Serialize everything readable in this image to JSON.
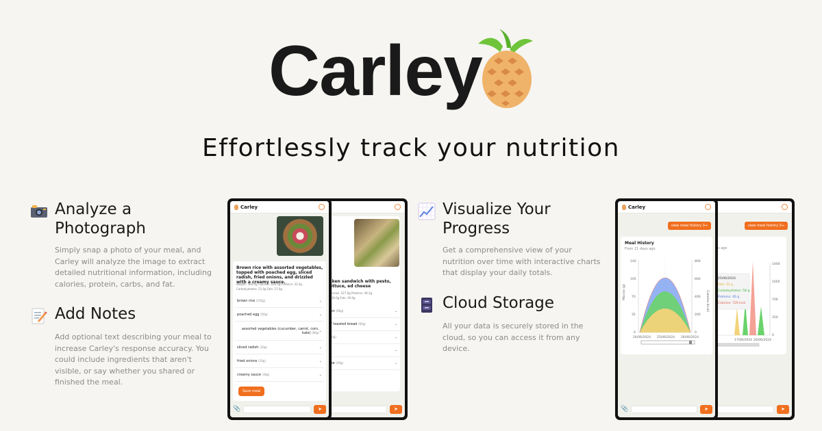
{
  "hero": {
    "title": "Carley",
    "tagline": "Effortlessly track your nutrition"
  },
  "features": [
    {
      "title": "Analyze a Photograph",
      "desc": "Simply snap a photo of your meal, and Carley will analyze the image to extract detailed nutritional information, including calories, protein, carbs, and fat.",
      "icon": "camera-icon"
    },
    {
      "title": "Add Notes",
      "desc": "Add optional text describing your meal to increase Carley's response accuracy. You could include ingredients that aren't visible, or say whether you shared or finished the meal.",
      "icon": "memo-icon"
    },
    {
      "title": "Visualize Your Progress",
      "desc": "Get a comprehensive view of your nutrition over time with interactive charts that display your daily totals.",
      "icon": "chart-icon"
    },
    {
      "title": "Cloud Storage",
      "desc": "All your data is securely stored in the cloud, so you can access it from any device.",
      "icon": "storage-icon"
    }
  ],
  "app": {
    "name": "Carley",
    "meal1": {
      "title": "Brown rice with assorted vegetables, topped with poached egg, sliced radish, fried onions, and drizzled with a creamy sauce.",
      "stats": "Weight: 560.0g  Calories: 690.0g  Proteins: 32.2g",
      "stats2": "Carbohydrates: 51.0g  Fats: 27.0g",
      "items": [
        {
          "name": "brown rice",
          "qty": "(150g)"
        },
        {
          "name": "poached egg",
          "qty": "(50g)"
        },
        {
          "name": "assorted vegetables (cucumber, carrot, corn, kale)",
          "qty": "(90g)"
        },
        {
          "name": "sliced radish",
          "qty": "(20g)"
        },
        {
          "name": "fried onions",
          "qty": "(10g)"
        },
        {
          "name": "creamy sauce",
          "qty": "(30g)"
        }
      ],
      "save": "Save meal"
    },
    "meal2": {
      "title": "icken sandwich with pesto, lettuce, ed cheese",
      "stats": "Calories: 527.0g  Proteins: 46.2g",
      "stats2": "s: 30.0g  Fats: 29.0g",
      "items": [
        {
          "name": "ken",
          "qty": "(90g)"
        },
        {
          "name": "of toasted bread",
          "qty": "(60g)"
        },
        {
          "name": "",
          "qty": "(20g)"
        },
        {
          "name": "e",
          "qty": ""
        },
        {
          "name": "ese",
          "qty": "(30g)"
        }
      ]
    },
    "history": {
      "button": "view meal history",
      "arrow": "3⇒",
      "title": "Meal History",
      "subtitle": "From 21 days ago",
      "subtitle2": "ays ago",
      "left_axis": "Macros (g)",
      "right_axis": "Calories (kcal)",
      "yticks_left": [
        "140",
        "105",
        "70",
        "35",
        "0"
      ],
      "yticks_right": [
        "800",
        "600",
        "400",
        "200",
        "0"
      ],
      "yticks_right2": [
        "1400",
        "1050",
        "700",
        "350",
        "0"
      ],
      "xticks": [
        "24/06/2024",
        "25/06/2024",
        "26/06/2024"
      ],
      "xticks2": [
        "17/06/2024",
        "26/06/2024"
      ],
      "tooltip": {
        "date": "25/06/2024",
        "fats": "Fats: 33 g",
        "carbs": "Carbohydrates: 58 g",
        "protein": "Proteins: 40 g",
        "calories": "Calories: 729 kcal"
      }
    }
  },
  "colors": {
    "accent": "#f06f1f",
    "fats": "#f2d37a",
    "carbs": "#6ad36b",
    "protein": "#7aa0f0",
    "calories": "#f07a6a"
  }
}
